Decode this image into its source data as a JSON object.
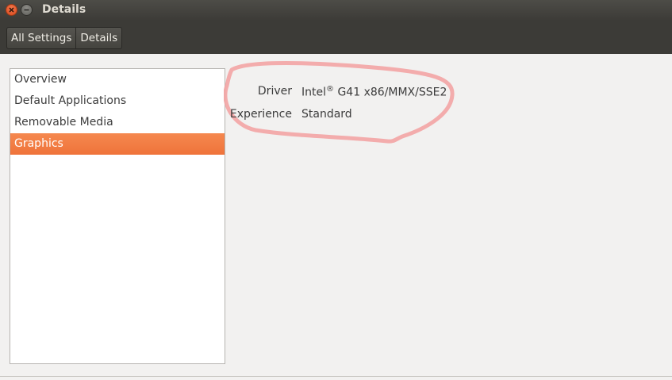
{
  "window": {
    "title": "Details",
    "close_icon": "close-icon",
    "minimize_icon": "minimize-icon"
  },
  "breadcrumb": {
    "items": [
      {
        "label": "All Settings"
      },
      {
        "label": "Details"
      }
    ]
  },
  "sidebar": {
    "items": [
      {
        "label": "Overview",
        "selected": false
      },
      {
        "label": "Default Applications",
        "selected": false
      },
      {
        "label": "Removable Media",
        "selected": false
      },
      {
        "label": "Graphics",
        "selected": true
      }
    ]
  },
  "details": {
    "driver_label": "Driver",
    "driver_value_prefix": "Intel",
    "driver_value_sup": "®",
    "driver_value_suffix": " G41 x86/MMX/SSE2",
    "experience_label": "Experience",
    "experience_value": "Standard"
  },
  "colors": {
    "accent": "#f07746",
    "titlebar": "#3c3b37",
    "annotation": "#f28a8a"
  }
}
